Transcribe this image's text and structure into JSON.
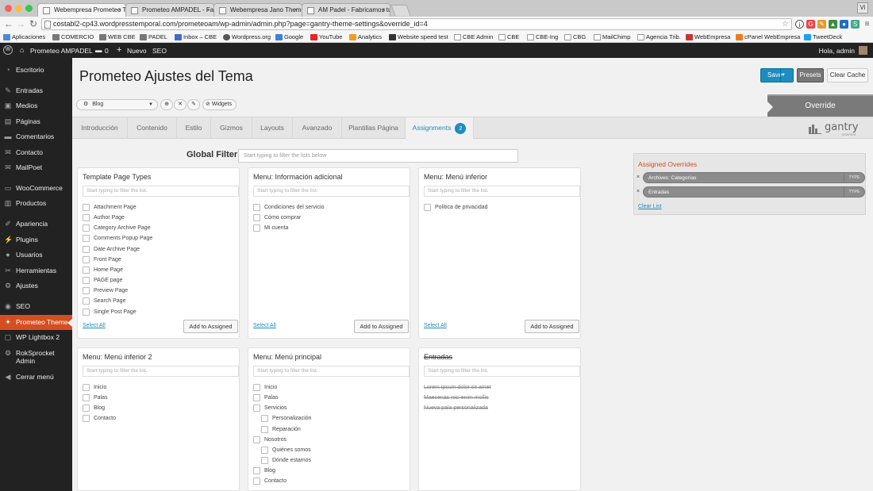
{
  "browser": {
    "tabs": [
      {
        "title": "Webempresa Prometeo Th"
      },
      {
        "title": "Prometeo AMPADEL - Fab"
      },
      {
        "title": "Webempresa Jano Theme"
      },
      {
        "title": "AM Padel - Fabricamos tu"
      }
    ],
    "window_button": "Vi",
    "url": "costabl2-cp43.wordpresstemporal.com/prometeoam/wp-admin/admin.php?page=gantry-theme-settings&override_id=4",
    "bookmarks": [
      "Aplicaciones",
      "COMERCIO",
      "WEB CBE",
      "PADEL",
      "Inbox – CBE",
      "Wordpress.org",
      "Google",
      "YouTube",
      "Analytics",
      "Website speed test",
      "CBE Admin",
      "CBE",
      "CBE-Ing",
      "CBG",
      "MailChimp",
      "Agencia Trib.",
      "WebEmpresa",
      "cPanel WebEmpresa",
      "TweetDeck"
    ]
  },
  "adminbar": {
    "site": "Prometeo AMPADEL",
    "comments": "0",
    "new": "Nuevo",
    "seo": "SEO",
    "greeting": "Hola, admin"
  },
  "sidebar": {
    "items": [
      {
        "label": "Escritorio",
        "icon": "dashboard-icon"
      },
      {
        "label": "Entradas",
        "icon": "pin-icon"
      },
      {
        "label": "Medios",
        "icon": "media-icon"
      },
      {
        "label": "Páginas",
        "icon": "pages-icon"
      },
      {
        "label": "Comentarios",
        "icon": "comments-icon"
      },
      {
        "label": "Contacto",
        "icon": "mail-icon"
      },
      {
        "label": "MailPoet",
        "icon": "mailpoet-icon"
      },
      {
        "label": "WooCommerce",
        "icon": "woocommerce-icon"
      },
      {
        "label": "Productos",
        "icon": "products-icon"
      },
      {
        "label": "Apariencia",
        "icon": "brush-icon"
      },
      {
        "label": "Plugins",
        "icon": "plugin-icon"
      },
      {
        "label": "Usuarios",
        "icon": "users-icon"
      },
      {
        "label": "Herramientas",
        "icon": "tools-icon"
      },
      {
        "label": "Ajustes",
        "icon": "settings-icon"
      },
      {
        "label": "SEO",
        "icon": "seo-icon"
      },
      {
        "label": "Prometeo Theme",
        "icon": "theme-icon"
      },
      {
        "label": "WP Lightbox 2",
        "icon": "lightbox-icon"
      },
      {
        "label": "RokSprocket Admin",
        "icon": "roksprocket-icon"
      },
      {
        "label": "Cerrar menú",
        "icon": "collapse-icon"
      }
    ]
  },
  "header": {
    "title": "Prometeo Ajustes del Tema",
    "save": "Save",
    "presets": "Presets",
    "clear_cache": "Clear Cache"
  },
  "toolbar": {
    "override_select": "Blog",
    "widgets": "Widgets",
    "override_label": "Override"
  },
  "tabs": [
    {
      "label": "Introducción"
    },
    {
      "label": "Contenido"
    },
    {
      "label": "Estilo"
    },
    {
      "label": "Gizmos"
    },
    {
      "label": "Layouts"
    },
    {
      "label": "Avanzado"
    },
    {
      "label": "Plantillas Página"
    },
    {
      "label": "Assignments",
      "badge": "2"
    }
  ],
  "logo": {
    "word": "gantry",
    "sub": "powered"
  },
  "filter": {
    "label": "Global Filter",
    "placeholder": "Start typing to filter the lists below",
    "list_placeholder": "Start typing to filter the list."
  },
  "panels": {
    "template_page_types": {
      "title": "Template Page Types",
      "items": [
        "Attachment Page",
        "Author Page",
        "Category Archive Page",
        "Comments Popup Page",
        "Date Archive Page",
        "Front Page",
        "Home Page",
        "PAGE page",
        "Preview Page",
        "Search Page",
        "Single Post Page"
      ]
    },
    "menu_info": {
      "title": "Menu: Información adicional",
      "items": [
        "Condiciones del servicio",
        "Cómo comprar",
        "Mi cuenta"
      ]
    },
    "menu_inferior": {
      "title": "Menu: Menú inferior",
      "items": [
        "Política de privacidad"
      ]
    },
    "menu_inferior_2": {
      "title": "Menu: Menú inferior 2",
      "items": [
        "Inicio",
        "Palas",
        "Blog",
        "Contacto"
      ]
    },
    "menu_principal": {
      "title": "Menu: Menú principal",
      "items": [
        "Inicio",
        "Palas",
        "Servicios",
        "Personalización",
        "Reparación",
        "Nosotros",
        "Quiénes somos",
        "Dónde estamos",
        "Blog",
        "Contacto"
      ]
    },
    "entradas": {
      "title": "Entradas",
      "items": [
        "Lorem ipsum dolor sit amet",
        "Maecenas nisi enim mollis",
        "Nueva pala personalizada"
      ]
    },
    "select_all": "Select All",
    "add_to_assigned": "Add to Assigned"
  },
  "assigned": {
    "title": "Assigned Overrides",
    "items": [
      {
        "label": "Archives: Categorías",
        "type": "TYPE"
      },
      {
        "label": "Entradas",
        "type": "TYPE"
      }
    ],
    "remove": "×",
    "clear_list": "Clear List"
  }
}
